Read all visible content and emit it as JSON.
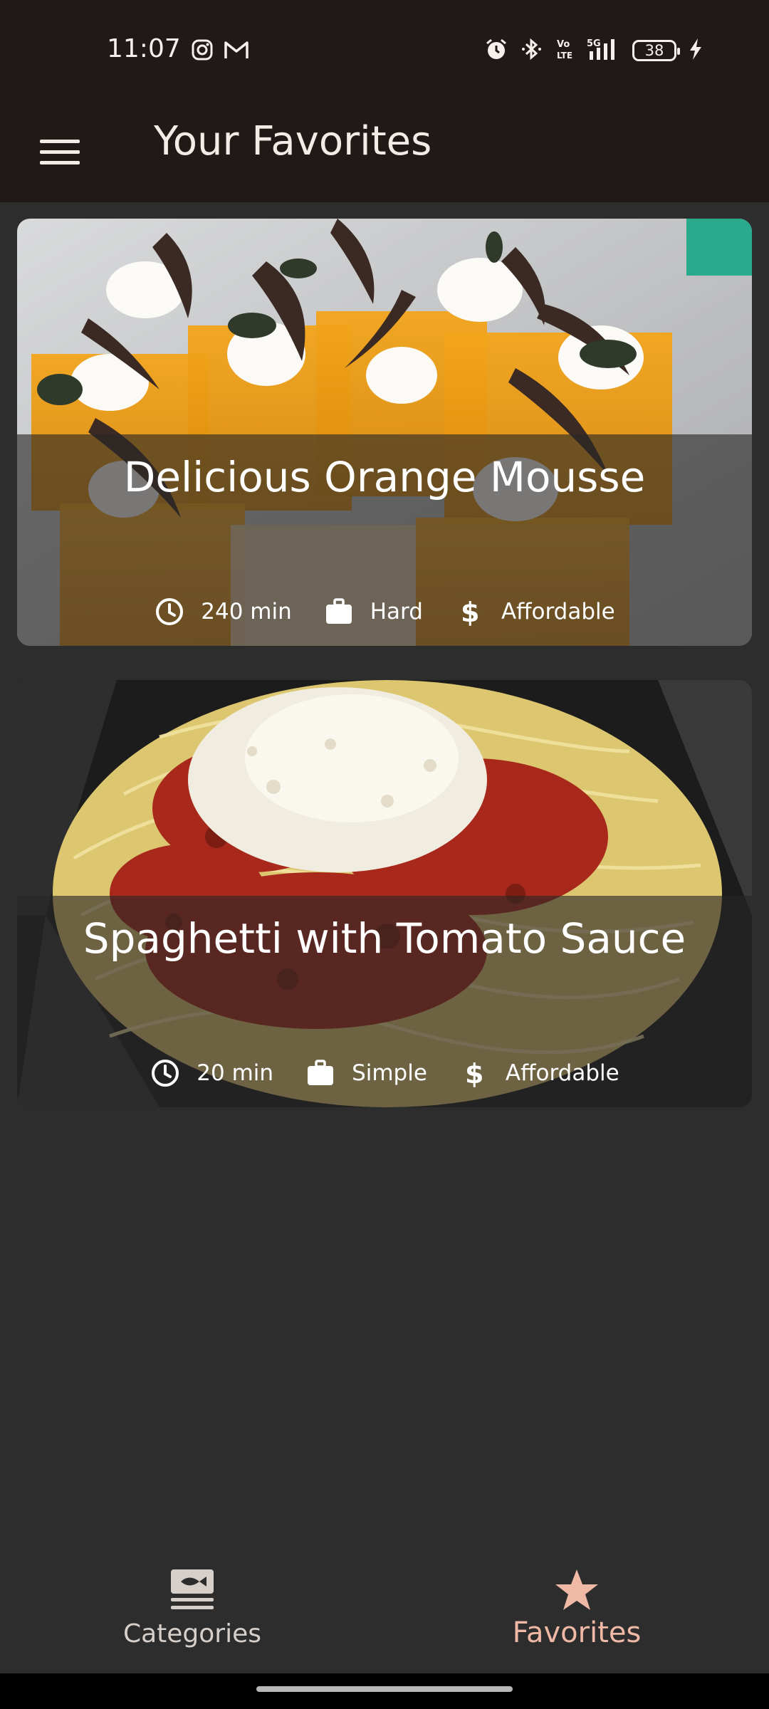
{
  "status_bar": {
    "time": "11:07",
    "battery": "38",
    "left_icons": [
      "instagram-icon",
      "gmail-icon"
    ],
    "right_icons": [
      "alarm-icon",
      "bluetooth-icon",
      "volte-icon",
      "5g-signal-icon",
      "battery-icon",
      "charging-icon"
    ]
  },
  "app_bar": {
    "menu_icon": "hamburger-menu-icon",
    "title": "Your Favorites"
  },
  "meals": [
    {
      "title": "Delicious Orange Mousse",
      "duration": "240 min",
      "complexity": "Hard",
      "affordability": "Affordable"
    },
    {
      "title": "Spaghetti with Tomato Sauce",
      "duration": "20 min",
      "complexity": "Simple",
      "affordability": "Affordable"
    }
  ],
  "bottom_nav": {
    "categories_label": "Categories",
    "favorites_label": "Favorites",
    "selected": "Favorites"
  },
  "colors": {
    "background": "#2e2d2d",
    "app_bar": "#1f1a17",
    "accent": "#efb9a6"
  }
}
